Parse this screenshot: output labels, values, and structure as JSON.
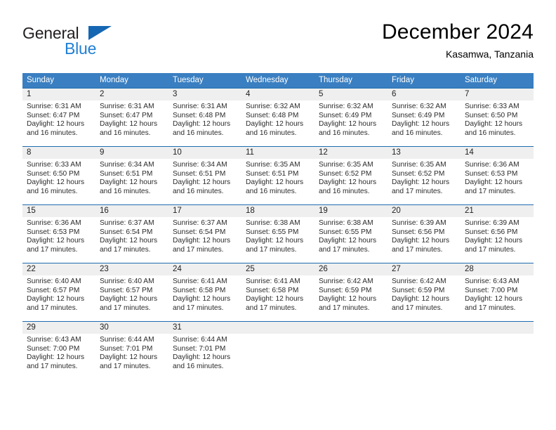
{
  "brand": {
    "word_one": "General",
    "word_two": "Blue",
    "accent_color": "#1567b3",
    "blue_text_color": "#1f7fd4"
  },
  "header": {
    "title": "December 2024",
    "subtitle": "Kasamwa, Tanzania"
  },
  "calendar": {
    "header_bg": "#3a7fc1",
    "row_line_color": "#1f6cb0",
    "daynum_bg": "#efefef",
    "weekdays": [
      "Sunday",
      "Monday",
      "Tuesday",
      "Wednesday",
      "Thursday",
      "Friday",
      "Saturday"
    ],
    "weeks": [
      [
        {
          "day": "1",
          "sunrise": "Sunrise: 6:31 AM",
          "sunset": "Sunset: 6:47 PM",
          "daylight_1": "Daylight: 12 hours",
          "daylight_2": "and 16 minutes."
        },
        {
          "day": "2",
          "sunrise": "Sunrise: 6:31 AM",
          "sunset": "Sunset: 6:47 PM",
          "daylight_1": "Daylight: 12 hours",
          "daylight_2": "and 16 minutes."
        },
        {
          "day": "3",
          "sunrise": "Sunrise: 6:31 AM",
          "sunset": "Sunset: 6:48 PM",
          "daylight_1": "Daylight: 12 hours",
          "daylight_2": "and 16 minutes."
        },
        {
          "day": "4",
          "sunrise": "Sunrise: 6:32 AM",
          "sunset": "Sunset: 6:48 PM",
          "daylight_1": "Daylight: 12 hours",
          "daylight_2": "and 16 minutes."
        },
        {
          "day": "5",
          "sunrise": "Sunrise: 6:32 AM",
          "sunset": "Sunset: 6:49 PM",
          "daylight_1": "Daylight: 12 hours",
          "daylight_2": "and 16 minutes."
        },
        {
          "day": "6",
          "sunrise": "Sunrise: 6:32 AM",
          "sunset": "Sunset: 6:49 PM",
          "daylight_1": "Daylight: 12 hours",
          "daylight_2": "and 16 minutes."
        },
        {
          "day": "7",
          "sunrise": "Sunrise: 6:33 AM",
          "sunset": "Sunset: 6:50 PM",
          "daylight_1": "Daylight: 12 hours",
          "daylight_2": "and 16 minutes."
        }
      ],
      [
        {
          "day": "8",
          "sunrise": "Sunrise: 6:33 AM",
          "sunset": "Sunset: 6:50 PM",
          "daylight_1": "Daylight: 12 hours",
          "daylight_2": "and 16 minutes."
        },
        {
          "day": "9",
          "sunrise": "Sunrise: 6:34 AM",
          "sunset": "Sunset: 6:51 PM",
          "daylight_1": "Daylight: 12 hours",
          "daylight_2": "and 16 minutes."
        },
        {
          "day": "10",
          "sunrise": "Sunrise: 6:34 AM",
          "sunset": "Sunset: 6:51 PM",
          "daylight_1": "Daylight: 12 hours",
          "daylight_2": "and 16 minutes."
        },
        {
          "day": "11",
          "sunrise": "Sunrise: 6:35 AM",
          "sunset": "Sunset: 6:51 PM",
          "daylight_1": "Daylight: 12 hours",
          "daylight_2": "and 16 minutes."
        },
        {
          "day": "12",
          "sunrise": "Sunrise: 6:35 AM",
          "sunset": "Sunset: 6:52 PM",
          "daylight_1": "Daylight: 12 hours",
          "daylight_2": "and 16 minutes."
        },
        {
          "day": "13",
          "sunrise": "Sunrise: 6:35 AM",
          "sunset": "Sunset: 6:52 PM",
          "daylight_1": "Daylight: 12 hours",
          "daylight_2": "and 17 minutes."
        },
        {
          "day": "14",
          "sunrise": "Sunrise: 6:36 AM",
          "sunset": "Sunset: 6:53 PM",
          "daylight_1": "Daylight: 12 hours",
          "daylight_2": "and 17 minutes."
        }
      ],
      [
        {
          "day": "15",
          "sunrise": "Sunrise: 6:36 AM",
          "sunset": "Sunset: 6:53 PM",
          "daylight_1": "Daylight: 12 hours",
          "daylight_2": "and 17 minutes."
        },
        {
          "day": "16",
          "sunrise": "Sunrise: 6:37 AM",
          "sunset": "Sunset: 6:54 PM",
          "daylight_1": "Daylight: 12 hours",
          "daylight_2": "and 17 minutes."
        },
        {
          "day": "17",
          "sunrise": "Sunrise: 6:37 AM",
          "sunset": "Sunset: 6:54 PM",
          "daylight_1": "Daylight: 12 hours",
          "daylight_2": "and 17 minutes."
        },
        {
          "day": "18",
          "sunrise": "Sunrise: 6:38 AM",
          "sunset": "Sunset: 6:55 PM",
          "daylight_1": "Daylight: 12 hours",
          "daylight_2": "and 17 minutes."
        },
        {
          "day": "19",
          "sunrise": "Sunrise: 6:38 AM",
          "sunset": "Sunset: 6:55 PM",
          "daylight_1": "Daylight: 12 hours",
          "daylight_2": "and 17 minutes."
        },
        {
          "day": "20",
          "sunrise": "Sunrise: 6:39 AM",
          "sunset": "Sunset: 6:56 PM",
          "daylight_1": "Daylight: 12 hours",
          "daylight_2": "and 17 minutes."
        },
        {
          "day": "21",
          "sunrise": "Sunrise: 6:39 AM",
          "sunset": "Sunset: 6:56 PM",
          "daylight_1": "Daylight: 12 hours",
          "daylight_2": "and 17 minutes."
        }
      ],
      [
        {
          "day": "22",
          "sunrise": "Sunrise: 6:40 AM",
          "sunset": "Sunset: 6:57 PM",
          "daylight_1": "Daylight: 12 hours",
          "daylight_2": "and 17 minutes."
        },
        {
          "day": "23",
          "sunrise": "Sunrise: 6:40 AM",
          "sunset": "Sunset: 6:57 PM",
          "daylight_1": "Daylight: 12 hours",
          "daylight_2": "and 17 minutes."
        },
        {
          "day": "24",
          "sunrise": "Sunrise: 6:41 AM",
          "sunset": "Sunset: 6:58 PM",
          "daylight_1": "Daylight: 12 hours",
          "daylight_2": "and 17 minutes."
        },
        {
          "day": "25",
          "sunrise": "Sunrise: 6:41 AM",
          "sunset": "Sunset: 6:58 PM",
          "daylight_1": "Daylight: 12 hours",
          "daylight_2": "and 17 minutes."
        },
        {
          "day": "26",
          "sunrise": "Sunrise: 6:42 AM",
          "sunset": "Sunset: 6:59 PM",
          "daylight_1": "Daylight: 12 hours",
          "daylight_2": "and 17 minutes."
        },
        {
          "day": "27",
          "sunrise": "Sunrise: 6:42 AM",
          "sunset": "Sunset: 6:59 PM",
          "daylight_1": "Daylight: 12 hours",
          "daylight_2": "and 17 minutes."
        },
        {
          "day": "28",
          "sunrise": "Sunrise: 6:43 AM",
          "sunset": "Sunset: 7:00 PM",
          "daylight_1": "Daylight: 12 hours",
          "daylight_2": "and 17 minutes."
        }
      ],
      [
        {
          "day": "29",
          "sunrise": "Sunrise: 6:43 AM",
          "sunset": "Sunset: 7:00 PM",
          "daylight_1": "Daylight: 12 hours",
          "daylight_2": "and 17 minutes."
        },
        {
          "day": "30",
          "sunrise": "Sunrise: 6:44 AM",
          "sunset": "Sunset: 7:01 PM",
          "daylight_1": "Daylight: 12 hours",
          "daylight_2": "and 17 minutes."
        },
        {
          "day": "31",
          "sunrise": "Sunrise: 6:44 AM",
          "sunset": "Sunset: 7:01 PM",
          "daylight_1": "Daylight: 12 hours",
          "daylight_2": "and 16 minutes."
        },
        {
          "day": "",
          "sunrise": "",
          "sunset": "",
          "daylight_1": "",
          "daylight_2": ""
        },
        {
          "day": "",
          "sunrise": "",
          "sunset": "",
          "daylight_1": "",
          "daylight_2": ""
        },
        {
          "day": "",
          "sunrise": "",
          "sunset": "",
          "daylight_1": "",
          "daylight_2": ""
        },
        {
          "day": "",
          "sunrise": "",
          "sunset": "",
          "daylight_1": "",
          "daylight_2": ""
        }
      ]
    ]
  }
}
